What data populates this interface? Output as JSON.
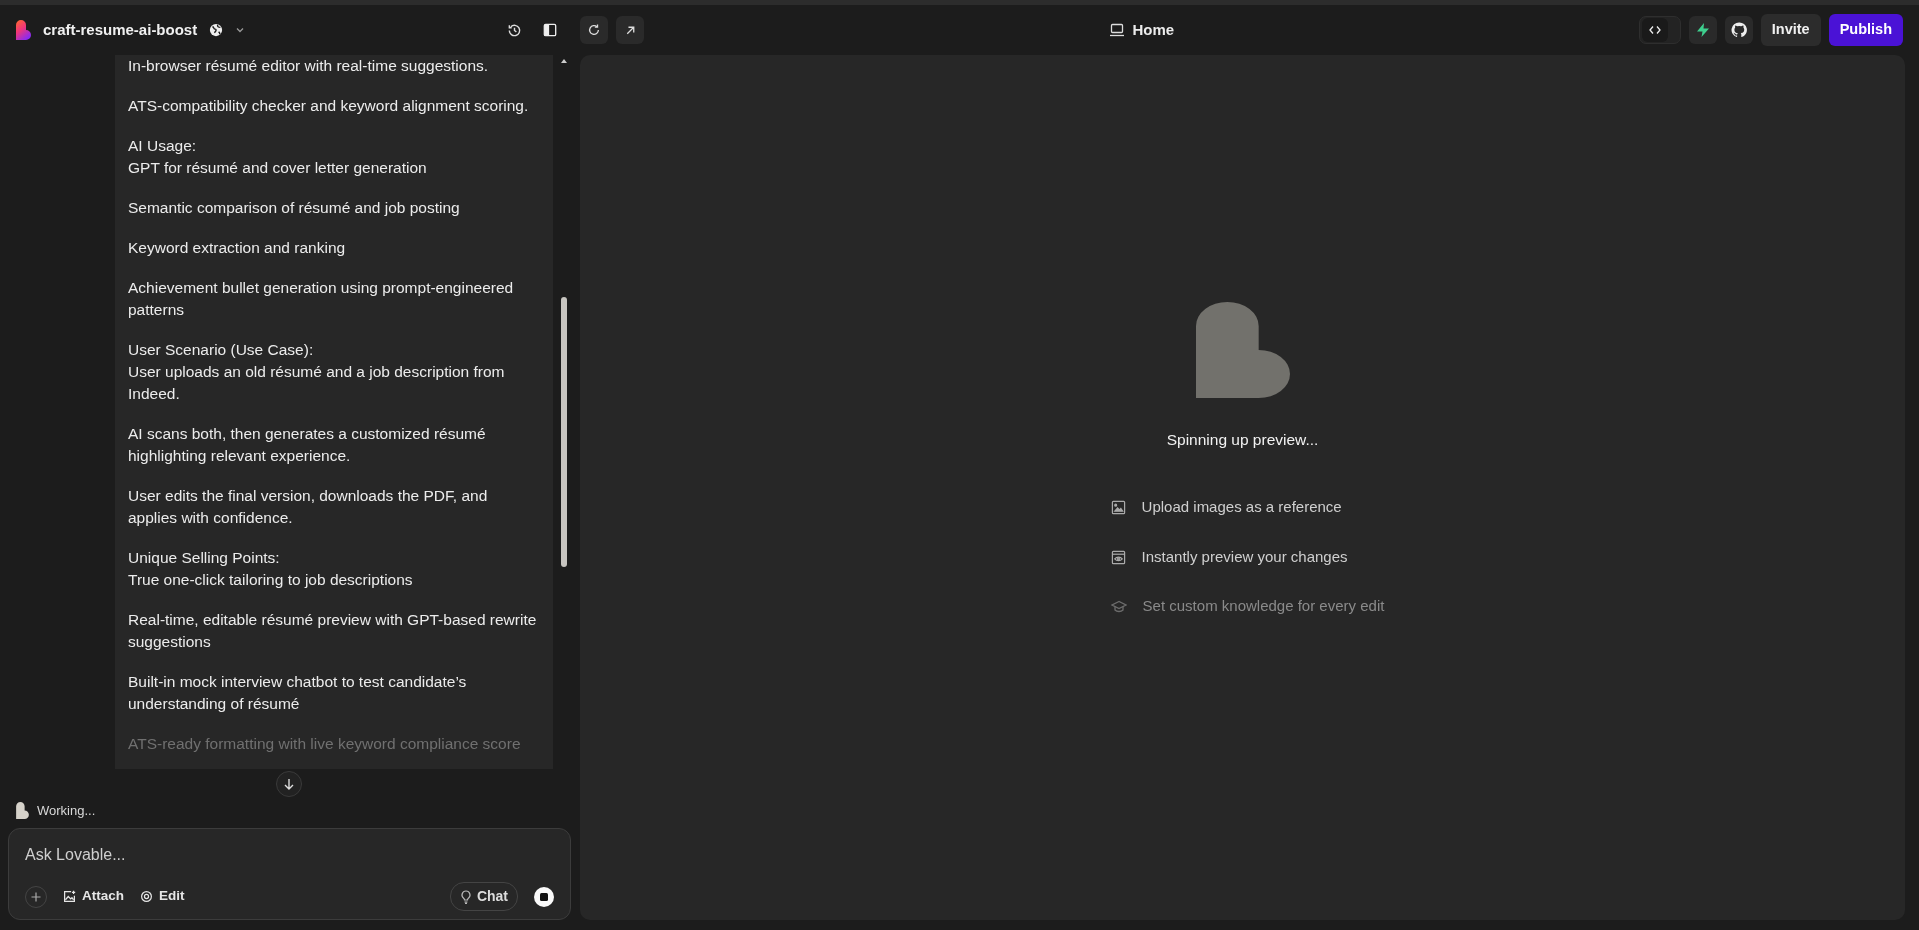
{
  "header": {
    "project_name": "craft-resume-ai-boost",
    "page_label": "Home",
    "code_toggle": {
      "on": false
    },
    "buttons": [
      {
        "kind": "invite",
        "label": "Invite"
      },
      {
        "kind": "publish",
        "label": "Publish"
      }
    ]
  },
  "chat": {
    "message_paragraphs": [
      {
        "lines": [
          "In-browser résumé editor with real-time suggestions."
        ],
        "faded": false
      },
      {
        "lines": [
          "ATS-compatibility checker and keyword alignment scoring."
        ],
        "faded": false
      },
      {
        "lines": [
          "AI Usage:",
          "GPT for résumé and cover letter generation"
        ],
        "faded": false
      },
      {
        "lines": [
          "Semantic comparison of résumé and job posting"
        ],
        "faded": false
      },
      {
        "lines": [
          "Keyword extraction and ranking"
        ],
        "faded": false
      },
      {
        "lines": [
          "Achievement bullet generation using prompt-engineered patterns"
        ],
        "faded": false
      },
      {
        "lines": [
          "User Scenario (Use Case):",
          "User uploads an old résumé and a job description from Indeed."
        ],
        "faded": false
      },
      {
        "lines": [
          "AI scans both, then generates a customized résumé highlighting relevant experience."
        ],
        "faded": false
      },
      {
        "lines": [
          "User edits the final version, downloads the PDF, and applies with confidence."
        ],
        "faded": false
      },
      {
        "lines": [
          "Unique Selling Points:",
          "True one-click tailoring to job descriptions"
        ],
        "faded": false
      },
      {
        "lines": [
          "Real-time, editable résumé preview with GPT-based rewrite suggestions"
        ],
        "faded": false
      },
      {
        "lines": [
          "Built-in mock interview chatbot to test candidate’s understanding of résumé"
        ],
        "faded": false
      },
      {
        "lines": [
          "ATS-ready formatting with live keyword compliance score"
        ],
        "faded": true
      }
    ],
    "status": "Working...",
    "input": {
      "placeholder": "Ask Lovable..."
    },
    "tools": [
      {
        "kind": "attach",
        "label": "Attach"
      },
      {
        "kind": "edit",
        "label": "Edit"
      }
    ],
    "mode_button": "Chat"
  },
  "preview": {
    "status": "Spinning up preview...",
    "tips": [
      {
        "kind": "image",
        "label": "Upload images as a reference",
        "dimmed": false
      },
      {
        "kind": "preview",
        "label": "Instantly preview your changes",
        "dimmed": false
      },
      {
        "kind": "knowledge",
        "label": "Set custom knowledge for every edit",
        "dimmed": true
      }
    ]
  }
}
